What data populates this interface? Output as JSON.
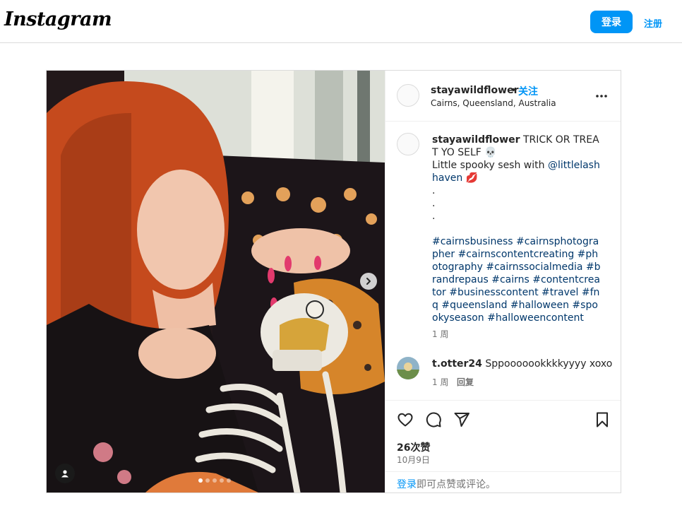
{
  "header": {
    "logo": "Instagram",
    "login_label": "登录",
    "signup_label": "注册"
  },
  "post": {
    "username": "stayawildflower",
    "separator": "•",
    "follow_label": "关注",
    "location": "Cairns, Queensland, Australia",
    "caption": {
      "username": "stayawildflower",
      "line1": " TRICK OR TREAT YO SELF 💀",
      "line2": "Little spooky sesh with ",
      "mention": "@littlelashhaven",
      "line2_end": " 💋",
      "dots": ".\n.\n.",
      "hashtags": "#cairnsbusiness #cairnsphotographer #cairnscontentcreating #photography #cairnssocialmedia #brandrepaus #cairns #contentcreator #businesscontent #travel #fnq #queensland #halloween #spookyseason #halloweencontent",
      "time": "1 周"
    },
    "comment": {
      "username": "t.otter24",
      "text": " Sppooooookkkkyyyy xoxo",
      "time": "1 周",
      "reply_label": "回复"
    },
    "likes": "26次赞",
    "date": "10月9日",
    "login_prompt_link": "登录",
    "login_prompt_text": "即可点赞或评论。",
    "carousel": {
      "count": 5,
      "active_index": 0
    }
  },
  "icons": {
    "more": "more-options-icon",
    "like": "heart-icon",
    "comment": "comment-bubble-icon",
    "share": "paper-plane-icon",
    "save": "bookmark-icon",
    "next": "chevron-right-icon",
    "tag": "user-tag-icon"
  },
  "colors": {
    "accent": "#0095f6",
    "link": "#00376b",
    "muted": "#737373",
    "border": "#dbdbdb"
  }
}
